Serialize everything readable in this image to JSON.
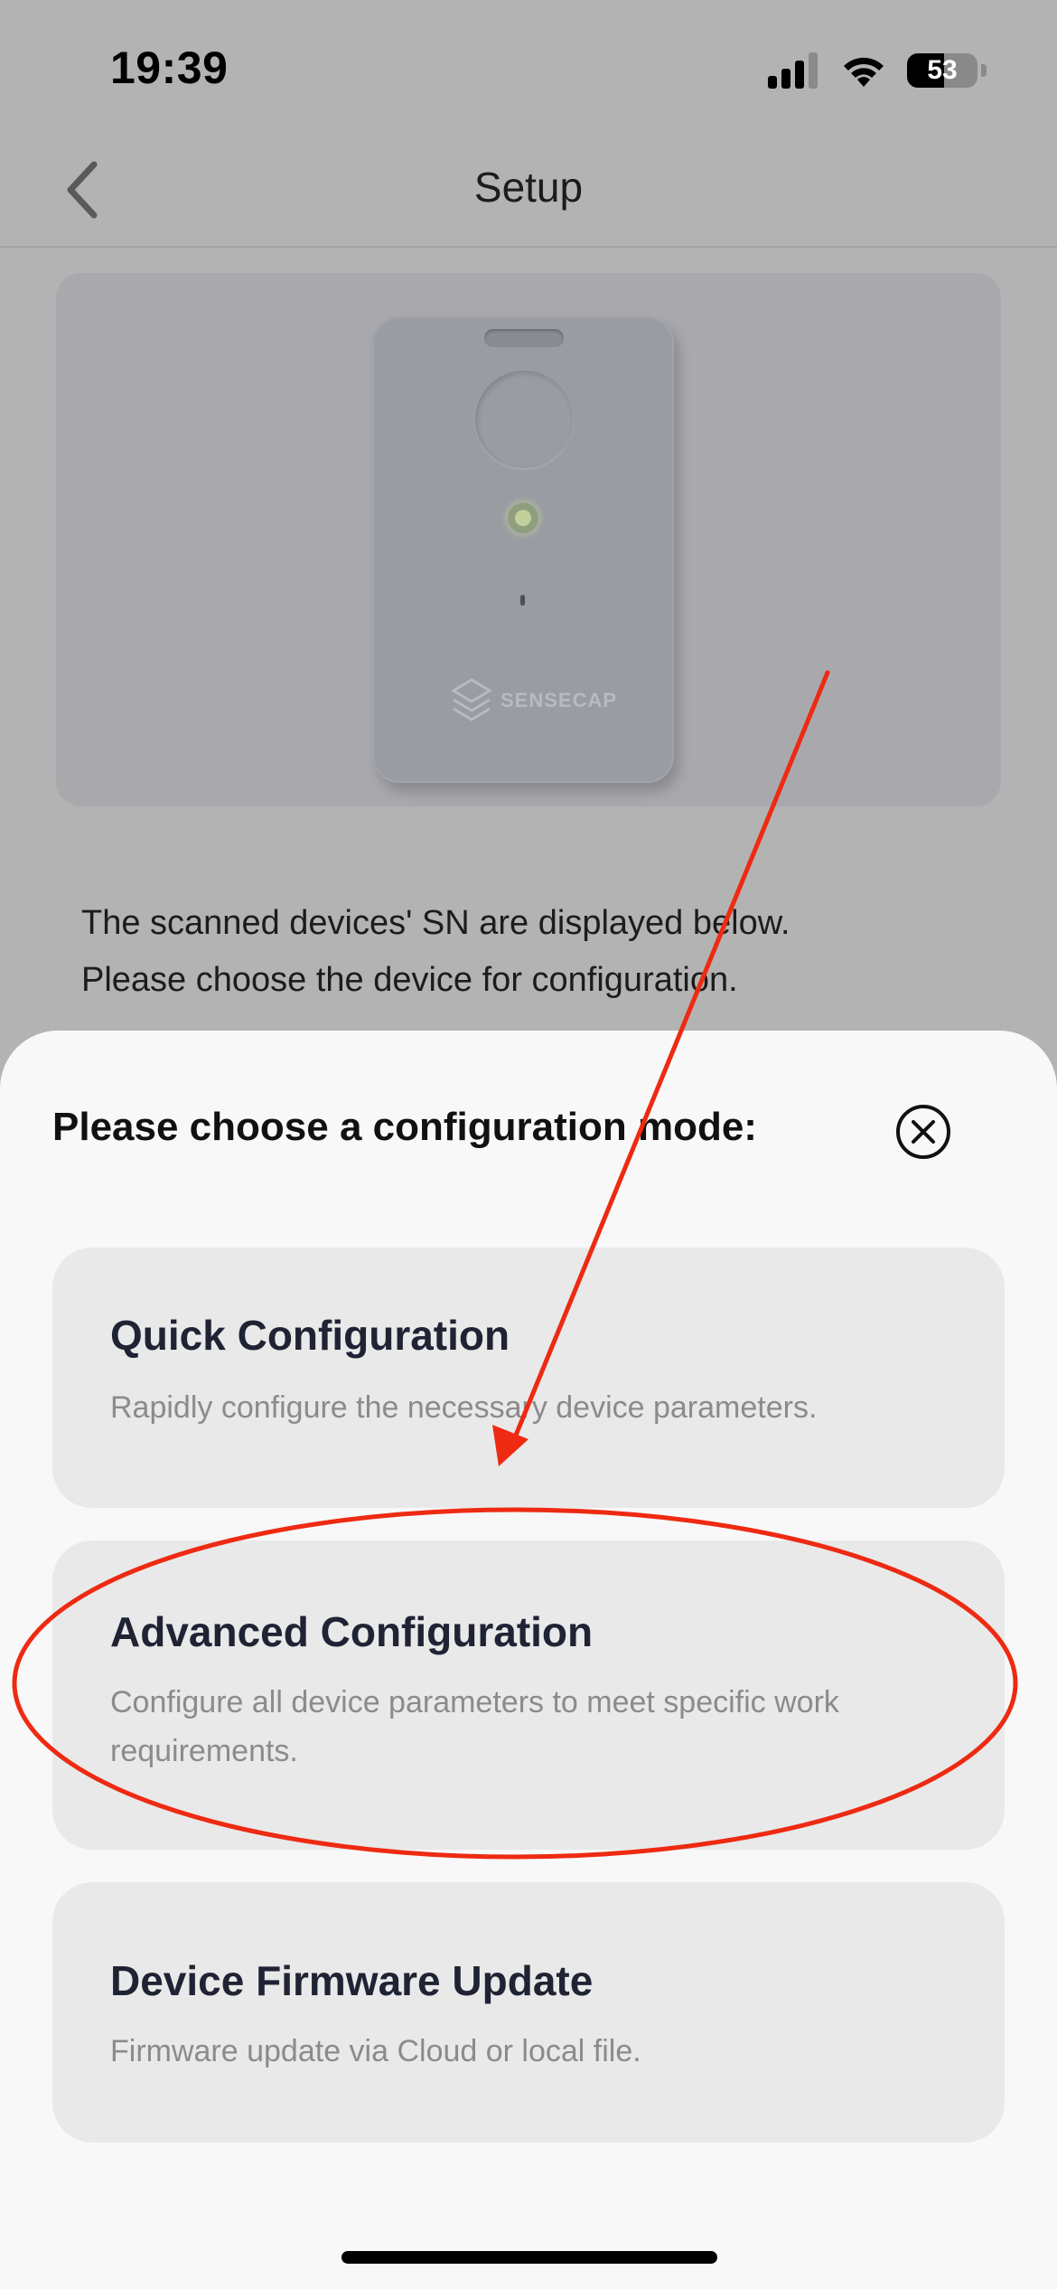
{
  "status_bar": {
    "time": "19:39",
    "battery_level": "53",
    "signal_icon": "cellular-signal-icon",
    "wifi_icon": "wifi-icon",
    "battery_icon": "battery-icon"
  },
  "nav": {
    "title": "Setup",
    "back_icon": "chevron-left-icon"
  },
  "device_image": {
    "logo_text": "SENSECAP"
  },
  "description": {
    "line1": "The scanned devices' SN are displayed below.",
    "line2": "Please choose the device for configuration."
  },
  "sheet": {
    "title": "Please choose a configuration mode:",
    "close_icon": "close-circle-icon",
    "options": [
      {
        "title": "Quick Configuration",
        "description": "Rapidly configure the necessary device parameters."
      },
      {
        "title": "Advanced Configuration",
        "description": "Configure all device parameters to meet specific work requirements."
      },
      {
        "title": "Device Firmware Update",
        "description": "Firmware update via Cloud or local file."
      }
    ]
  },
  "annotation": {
    "color": "#ee2a12",
    "marks": [
      "red-arrow",
      "red-ellipse"
    ]
  },
  "colors": {
    "sheet_background": "#f8f8f8",
    "card_background": "#e9e9e9",
    "dimmed_background": "#b3b3b3",
    "title_text": "#1f2333",
    "secondary_text": "#8b8b8f"
  }
}
